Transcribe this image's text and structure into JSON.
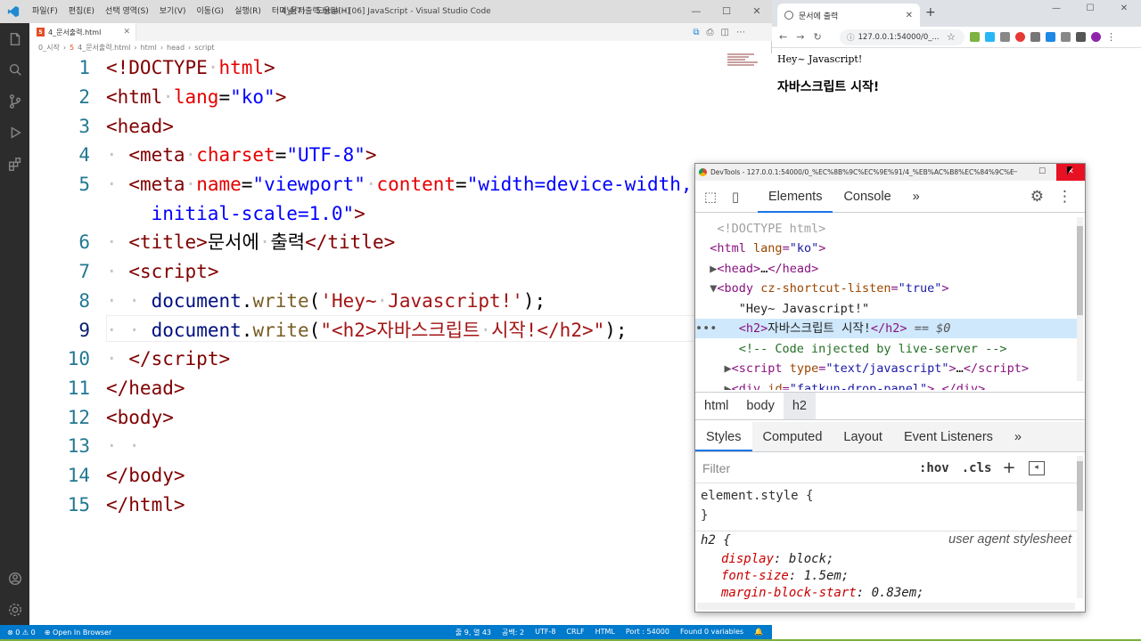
{
  "vscode": {
    "menu": [
      "파일(F)",
      "편집(E)",
      "선택 영역(S)",
      "보기(V)",
      "이동(G)",
      "실행(R)",
      "터미널(T)",
      "도움말(H)"
    ],
    "window_title": "4_문서출력.html - [06] JavaScript - Visual Studio Code",
    "tab_label": "4_문서출력.html",
    "breadcrumb": [
      "0_시작",
      "4_문서출력.html",
      "html",
      "head",
      "script"
    ],
    "line_numbers": [
      "1",
      "2",
      "3",
      "4",
      "5",
      "",
      "6",
      "7",
      "8",
      "9",
      "10",
      "11",
      "12",
      "13",
      "14",
      "15"
    ],
    "status": {
      "problems": "⊗ 0 ⚠ 0",
      "open_in_browser": "Open In Browser",
      "position": "줄 9, 열 43",
      "spaces": "공백: 2",
      "encoding": "UTF-8",
      "eol": "CRLF",
      "language": "HTML",
      "port": "Port : 54000",
      "variables": "Found 0 variables"
    }
  },
  "browser": {
    "tab_title": "문서에 출력",
    "url": "127.0.0.1:54000/0_...",
    "page_text": "Hey~ Javascript!",
    "page_h2": "자바스크립트 시작!"
  },
  "devtools": {
    "title": "DevTools - 127.0.0.1:54000/0_%EC%8B%9C%EC%9E%91/4_%EB%AC%B8%EC%84%9C%E...",
    "tabs": [
      "Elements",
      "Console"
    ],
    "crumbs": [
      "html",
      "body",
      "h2"
    ],
    "subtabs": [
      "Styles",
      "Computed",
      "Layout",
      "Event Listeners"
    ],
    "filter_placeholder": "Filter",
    "hov": ":hov",
    "cls": ".cls",
    "element_style": "element.style {",
    "close_brace": "}",
    "ua_selector": "h2 {",
    "ua_label": "user agent stylesheet",
    "ua_props": [
      {
        "prop": "display",
        "val": "block;"
      },
      {
        "prop": "font-size",
        "val": "1.5em;"
      },
      {
        "prop": "margin-block-start",
        "val": "0.83em;"
      }
    ]
  }
}
